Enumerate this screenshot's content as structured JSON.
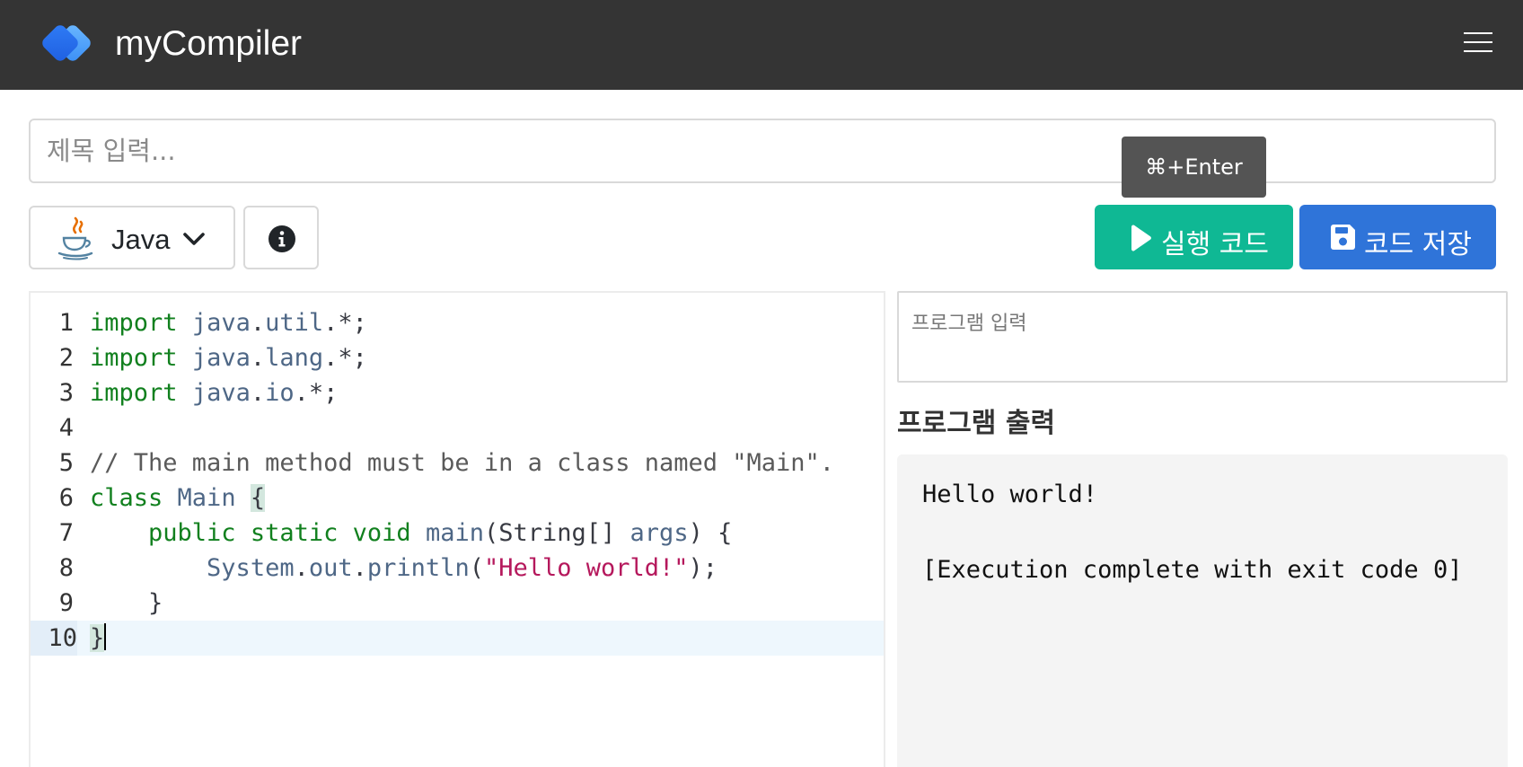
{
  "app": {
    "brand": "myCompiler"
  },
  "title_field": {
    "placeholder": "제목 입력..."
  },
  "toolbar": {
    "language": "Java",
    "run_tooltip": "⌘+Enter",
    "run_label": "실행 코드",
    "save_label": "코드 저장"
  },
  "editor": {
    "line_numbers": [
      "1",
      "2",
      "3",
      "4",
      "5",
      "6",
      "7",
      "8",
      "9",
      "10"
    ],
    "active_line": 10,
    "lines": [
      "import java.util.*;",
      "import java.lang.*;",
      "import java.io.*;",
      "",
      "// The main method must be in a class named \"Main\".",
      "class Main {",
      "    public static void main(String[] args) {",
      "        System.out.println(\"Hello world!\");",
      "    }",
      "}"
    ]
  },
  "stdin": {
    "placeholder": "프로그램 입력"
  },
  "output": {
    "heading": "프로그램 출력",
    "line1": "Hello world!",
    "line2": "",
    "line3": "[Execution complete with exit code 0]"
  },
  "colors": {
    "navbar": "#343434",
    "run_button": "#0fb894",
    "save_button": "#2f74d9",
    "keyword": "#11801e",
    "identifier": "#4e6786",
    "string": "#b5185c"
  },
  "icons": {
    "logo": "diamond-logo-icon",
    "menu": "hamburger-menu-icon",
    "language": "java-cup-icon",
    "dropdown": "chevron-down-icon",
    "info": "info-circle-icon",
    "run": "play-icon",
    "save": "floppy-disk-icon"
  }
}
